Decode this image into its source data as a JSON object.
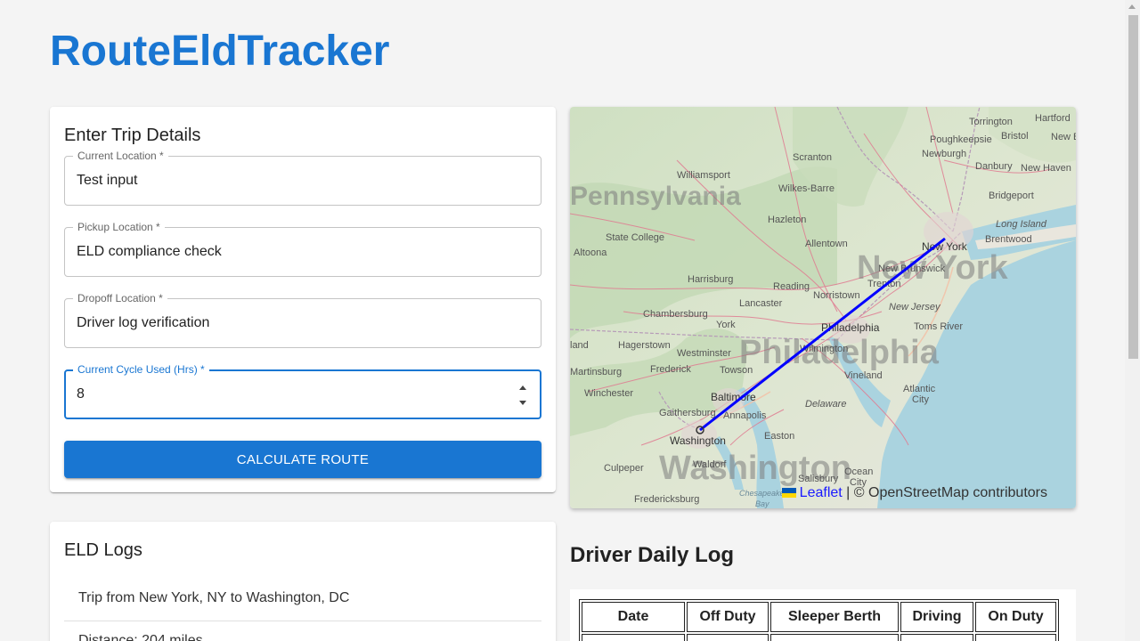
{
  "app": {
    "title": "RouteEldTracker"
  },
  "trip_form": {
    "title": "Enter Trip Details",
    "fields": [
      {
        "label": "Current Location *",
        "value": "Test input"
      },
      {
        "label": "Pickup Location *",
        "value": "ELD compliance check"
      },
      {
        "label": "Dropoff Location *",
        "value": "Driver log verification"
      },
      {
        "label": "Current Cycle Used (Hrs) *",
        "value": "8"
      }
    ],
    "submit_label": "CALCULATE ROUTE"
  },
  "map": {
    "attribution_link": "Leaflet",
    "attribution_text": "| © OpenStreetMap contributors",
    "route_color": "#0000ff",
    "labels": {
      "torrington": "Torrington",
      "hartford": "Hartford",
      "poughkeepsie": "Poughkeepsie",
      "bristol": "Bristol",
      "new_britain": "New B",
      "williamsport": "Williamsport",
      "scranton": "Scranton",
      "newburgh": "Newburgh",
      "danbury": "Danbury",
      "new_haven": "New Haven",
      "pennsylvania": "Pennsylvania",
      "wilkes_barre": "Wilkes-Barre",
      "bridgeport": "Bridgeport",
      "hazleton": "Hazleton",
      "long_island": "Long Island",
      "state_college": "State College",
      "allentown": "Allentown",
      "brentwood": "Brentwood",
      "altoona": "Altoona",
      "new_york_city": "New York",
      "new_york_state": "New York",
      "new_brunswick": "New Brunswick",
      "harrisburg": "Harrisburg",
      "reading": "Reading",
      "trenton": "Trenton",
      "norristown": "Norristown",
      "chambersburg": "Chambersburg",
      "lancaster": "Lancaster",
      "new_jersey": "New Jersey",
      "york": "York",
      "philadelphia_city": "Philadelphia",
      "toms_river": "Toms River",
      "hagerstown": "Hagerstown",
      "philadelphia_big": "Philadelphia",
      "land": "land",
      "westminster": "Westminster",
      "wilmington": "Wilmington",
      "martinsburg": "Martinsburg",
      "frederick": "Frederick",
      "towson": "Towson",
      "vineland": "Vineland",
      "atlantic_city_1": "Atlantic",
      "atlantic_city_2": "City",
      "winchester": "Winchester",
      "baltimore": "Baltimore",
      "delaware": "Delaware",
      "gaithersburg": "Gaithersburg",
      "annapolis": "Annapolis",
      "washington_city": "Washington",
      "easton": "Easton",
      "culpeper": "Culpeper",
      "waldorf": "Waldorf",
      "washington_big": "Washington",
      "ocean_city_1": "Ocean",
      "ocean_city_2": "City",
      "salisbury": "Salisbury",
      "chesapeake_bay_1": "Chesapeake",
      "chesapeake_bay_2": "Bay",
      "fredericksburg": "Fredericksburg"
    }
  },
  "eld_logs": {
    "title": "ELD Logs",
    "items": [
      "Trip from New York, NY to Washington, DC",
      "Distance: 204 miles"
    ]
  },
  "daily_log": {
    "title": "Driver Daily Log",
    "columns": [
      "Date",
      "Off Duty",
      "Sleeper Berth",
      "Driving",
      "On Duty"
    ]
  }
}
